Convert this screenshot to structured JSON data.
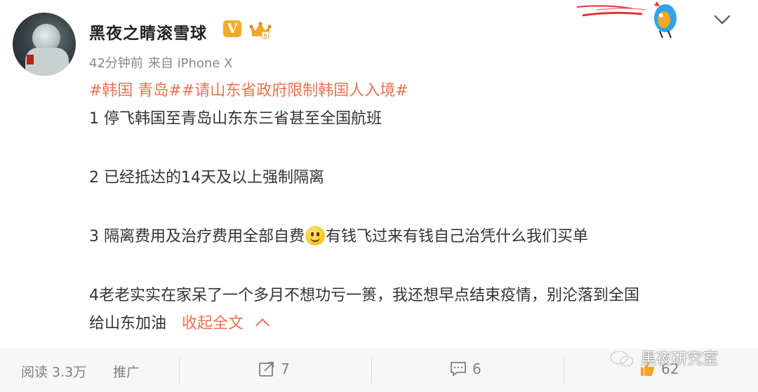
{
  "post": {
    "username": "黑夜之睛滚雪球",
    "verified_badge": "V",
    "time": "42分钟前",
    "source": "来自 iPhone X",
    "topic_line": "#韩国 青岛##请山东省政府限制韩国人入境#",
    "line1": "1  停飞韩国至青岛山东东三省甚至全国航班",
    "line2": "2  已经抵达的14天及以上强制隔离",
    "line3a": "3  隔离费用及治疗费用全部自费",
    "line3b": "有钱飞过来有钱自己治凭什么我们买单",
    "line4": "4老老实实在家呆了一个多月不想功亏一篑，我还想早点结束疫情，别沦落到全国",
    "line5": "给山东加油",
    "collapse_label": "收起全文"
  },
  "footer": {
    "reads": "阅读 3.3万",
    "promote": "推广",
    "repost_count": "7",
    "comment_count": "6",
    "like_count": "62"
  },
  "watermark": "黑夜研究室",
  "icons": {
    "verified": "verified-v-icon",
    "member": "crown-member-icon",
    "menu": "chevron-down-icon",
    "emoji": "smile-emoji-icon",
    "repost": "repost-icon",
    "comment": "comment-icon",
    "like": "thumbs-up-icon",
    "watermark": "wechat-icon"
  },
  "colors": {
    "topic": "#eb7350",
    "badge": "#f7a928",
    "footer_bg": "#f7f7f7",
    "muted": "#808080"
  }
}
